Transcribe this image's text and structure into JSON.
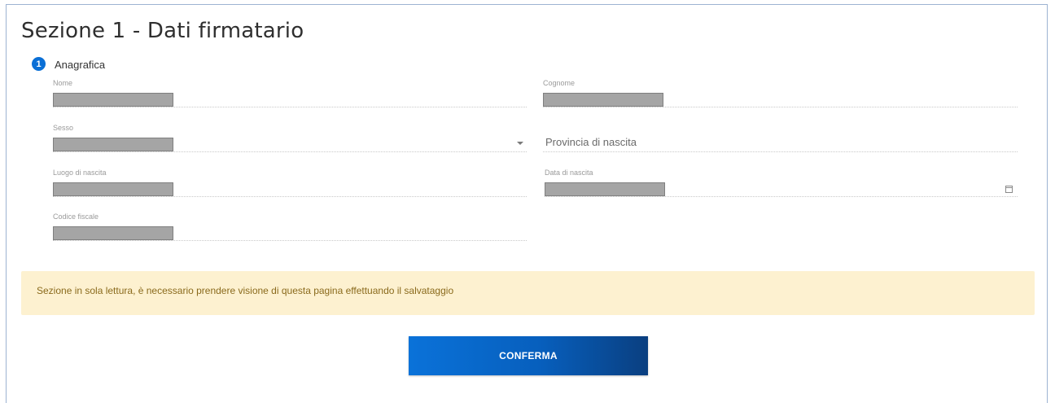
{
  "section": {
    "title": "Sezione 1 - Dati firmatario",
    "step_number": "1",
    "step_label": "Anagrafica"
  },
  "fields": {
    "nome": {
      "label": "Nome"
    },
    "cognome": {
      "label": "Cognome"
    },
    "sesso": {
      "label": "Sesso",
      "type": "select"
    },
    "provincia": {
      "placeholder": "Provincia di nascita"
    },
    "luogo": {
      "label": "Luogo di nascita"
    },
    "data": {
      "label": "Data di nascita",
      "type": "date"
    },
    "codice": {
      "label": "Codice fiscale"
    }
  },
  "notice": {
    "text": "Sezione in sola lettura, è necessario prendere visione di questa pagina effettuando il salvataggio"
  },
  "actions": {
    "confirm_label": "CONFERMA"
  },
  "colors": {
    "accent": "#0a6fd6",
    "button_dark": "#0a3f80",
    "notice_bg": "#fdf1d0",
    "redacted": "#a5a5a5"
  },
  "icons": {
    "select_caret": "chevron-down-icon",
    "date_picker": "calendar-icon"
  }
}
